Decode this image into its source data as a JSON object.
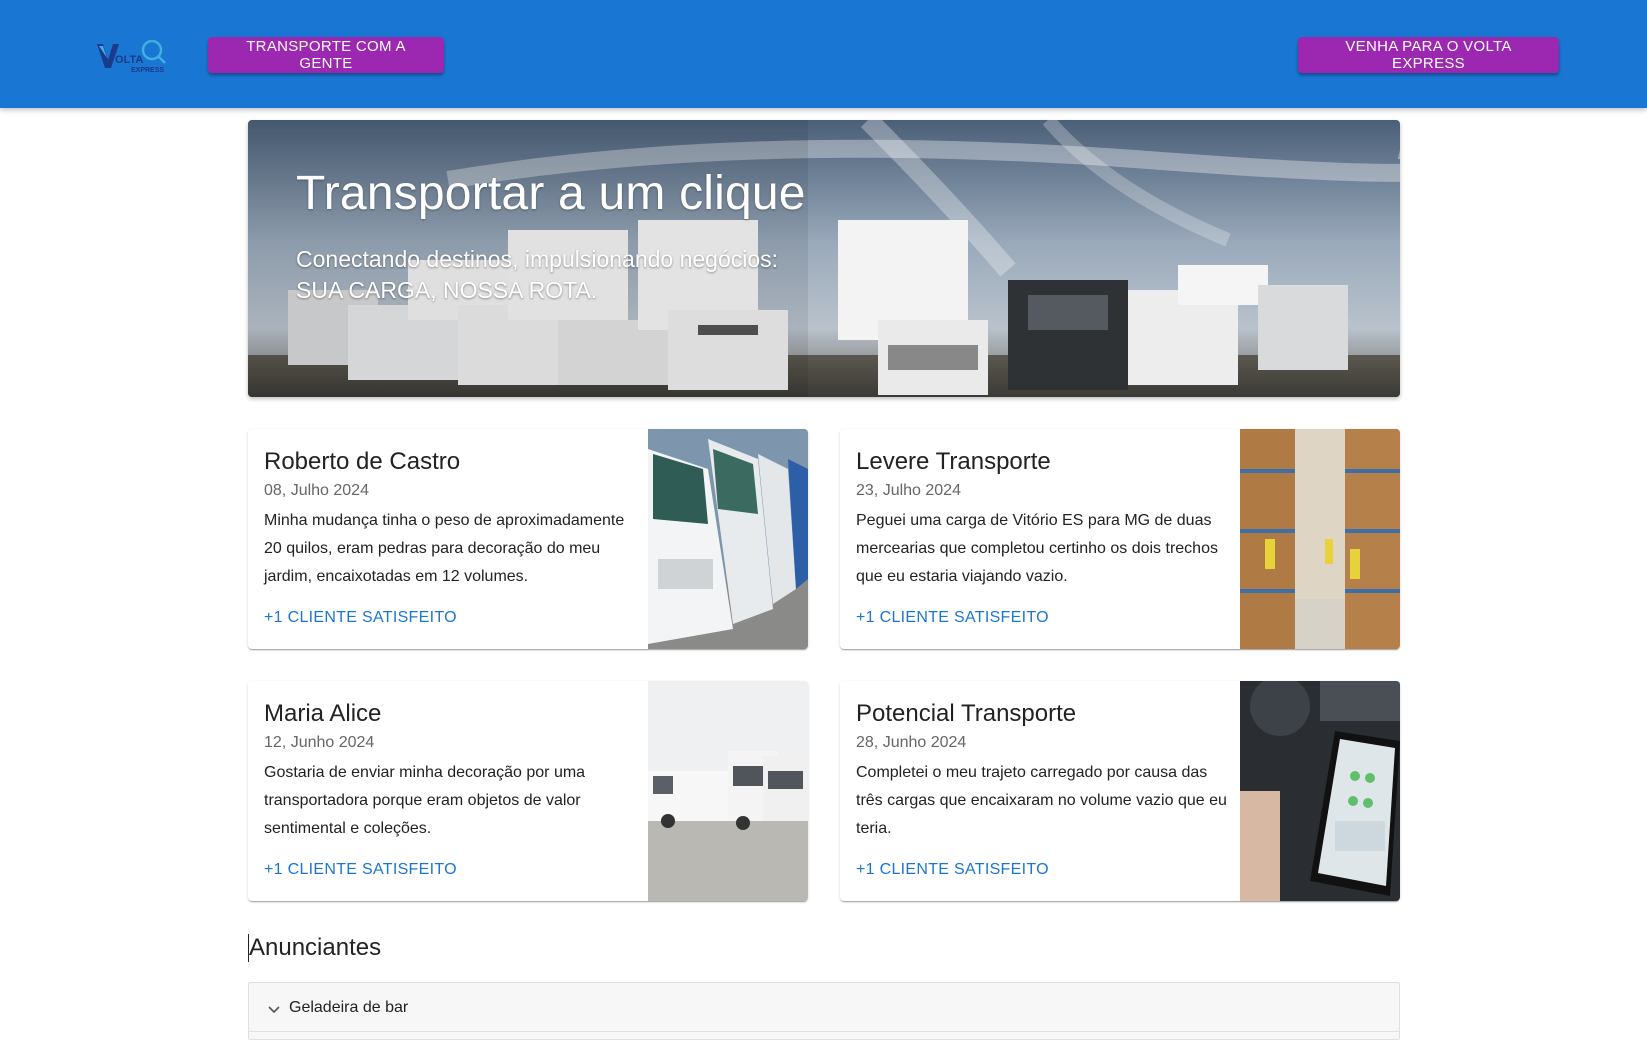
{
  "header": {
    "logo_name": "Volta Express",
    "nav_button": "TRANSPORTE COM A GENTE",
    "cta_button": "VENHA PARA O VOLTA EXPRESS"
  },
  "hero": {
    "title": "Transportar a um clique",
    "subtitle_line1": "Conectando destinos, impulsionando negócios:",
    "subtitle_line2": "SUA CARGA, NOSSA ROTA."
  },
  "testimonials": [
    {
      "name": "Roberto de Castro",
      "date": "08, Julho 2024",
      "text": "Minha mudança tinha o peso de aproximadamente 20 quilos, eram pedras para decoração do meu jardim, encaixotadas em 12 volumes.",
      "link": "+1 CLIENTE SATISFEITO",
      "image": "trucks-photo"
    },
    {
      "name": "Levere Transporte",
      "date": "23, Julho 2024",
      "text": "Peguei uma carga de Vitório ES para MG de duas mercearias que completou certinho os dois trechos que eu estaria viajando vazio.",
      "link": "+1 CLIENTE SATISFEITO",
      "image": "warehouse-photo"
    },
    {
      "name": "Maria Alice",
      "date": "12, Junho 2024",
      "text": "Gostaria de enviar minha decoração por uma transportadora porque eram objetos de valor sentimental e coleções.",
      "link": "+1 CLIENTE SATISFEITO",
      "image": "vans-photo"
    },
    {
      "name": "Potencial Transporte",
      "date": "28, Junho 2024",
      "text": "Completei o meu trajeto carregado por causa das três cargas que encaixaram no volume vazio que eu teria.",
      "link": "+1 CLIENTE SATISFEITO",
      "image": "phone-in-car-photo"
    }
  ],
  "advertisers": {
    "title": "Anunciantes",
    "items": [
      {
        "label": "Geladeira de bar"
      }
    ]
  },
  "colors": {
    "appbar": "#1976d2",
    "button": "#9c27b0",
    "link": "#1976d2"
  }
}
